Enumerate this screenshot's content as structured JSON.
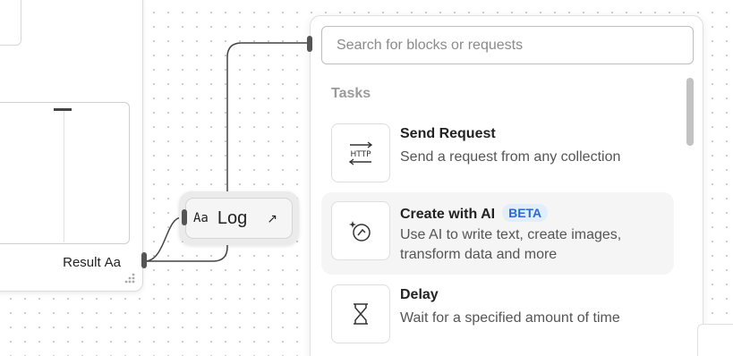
{
  "left_block": {
    "result_label": "Result",
    "result_type": "Aa"
  },
  "log_node": {
    "type_label": "Aa",
    "label": "Log",
    "open_icon": "arrow-up-right-icon"
  },
  "picker": {
    "search_placeholder": "Search for blocks or requests",
    "search_value": "",
    "section_title": "Tasks",
    "items": [
      {
        "icon": "http-icon",
        "title": "Send Request",
        "badge": "",
        "description": "Send a request from any collection"
      },
      {
        "icon": "ai-sparkle-icon",
        "title": "Create with AI",
        "badge": "BETA",
        "description": "Use AI to write text, create images, transform data and more"
      },
      {
        "icon": "hourglass-icon",
        "title": "Delay",
        "badge": "",
        "description": "Wait for a specified amount of time"
      }
    ]
  },
  "colors": {
    "beta_badge_bg": "#e3eefc",
    "beta_badge_text": "#2a6ad6",
    "wire": "#444444"
  }
}
